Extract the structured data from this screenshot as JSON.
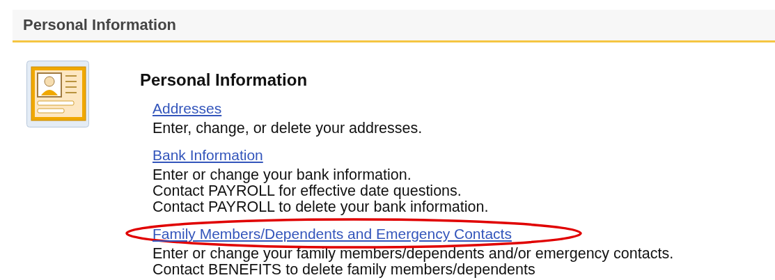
{
  "panel": {
    "title": "Personal Information"
  },
  "section": {
    "title": "Personal Information",
    "items": [
      {
        "link": "Addresses",
        "highlighted": false,
        "lines": [
          "Enter, change, or delete your addresses."
        ]
      },
      {
        "link": "Bank Information",
        "highlighted": false,
        "lines": [
          "Enter or change your bank information.",
          "Contact PAYROLL for effective date questions.",
          "Contact PAYROLL to delete your bank information."
        ]
      },
      {
        "link": "Family Members/Dependents and Emergency Contacts",
        "highlighted": true,
        "lines": [
          "Enter or change your family members/dependents and/or emergency contacts.",
          "Contact BENEFITS to delete family members/dependents"
        ]
      }
    ]
  }
}
